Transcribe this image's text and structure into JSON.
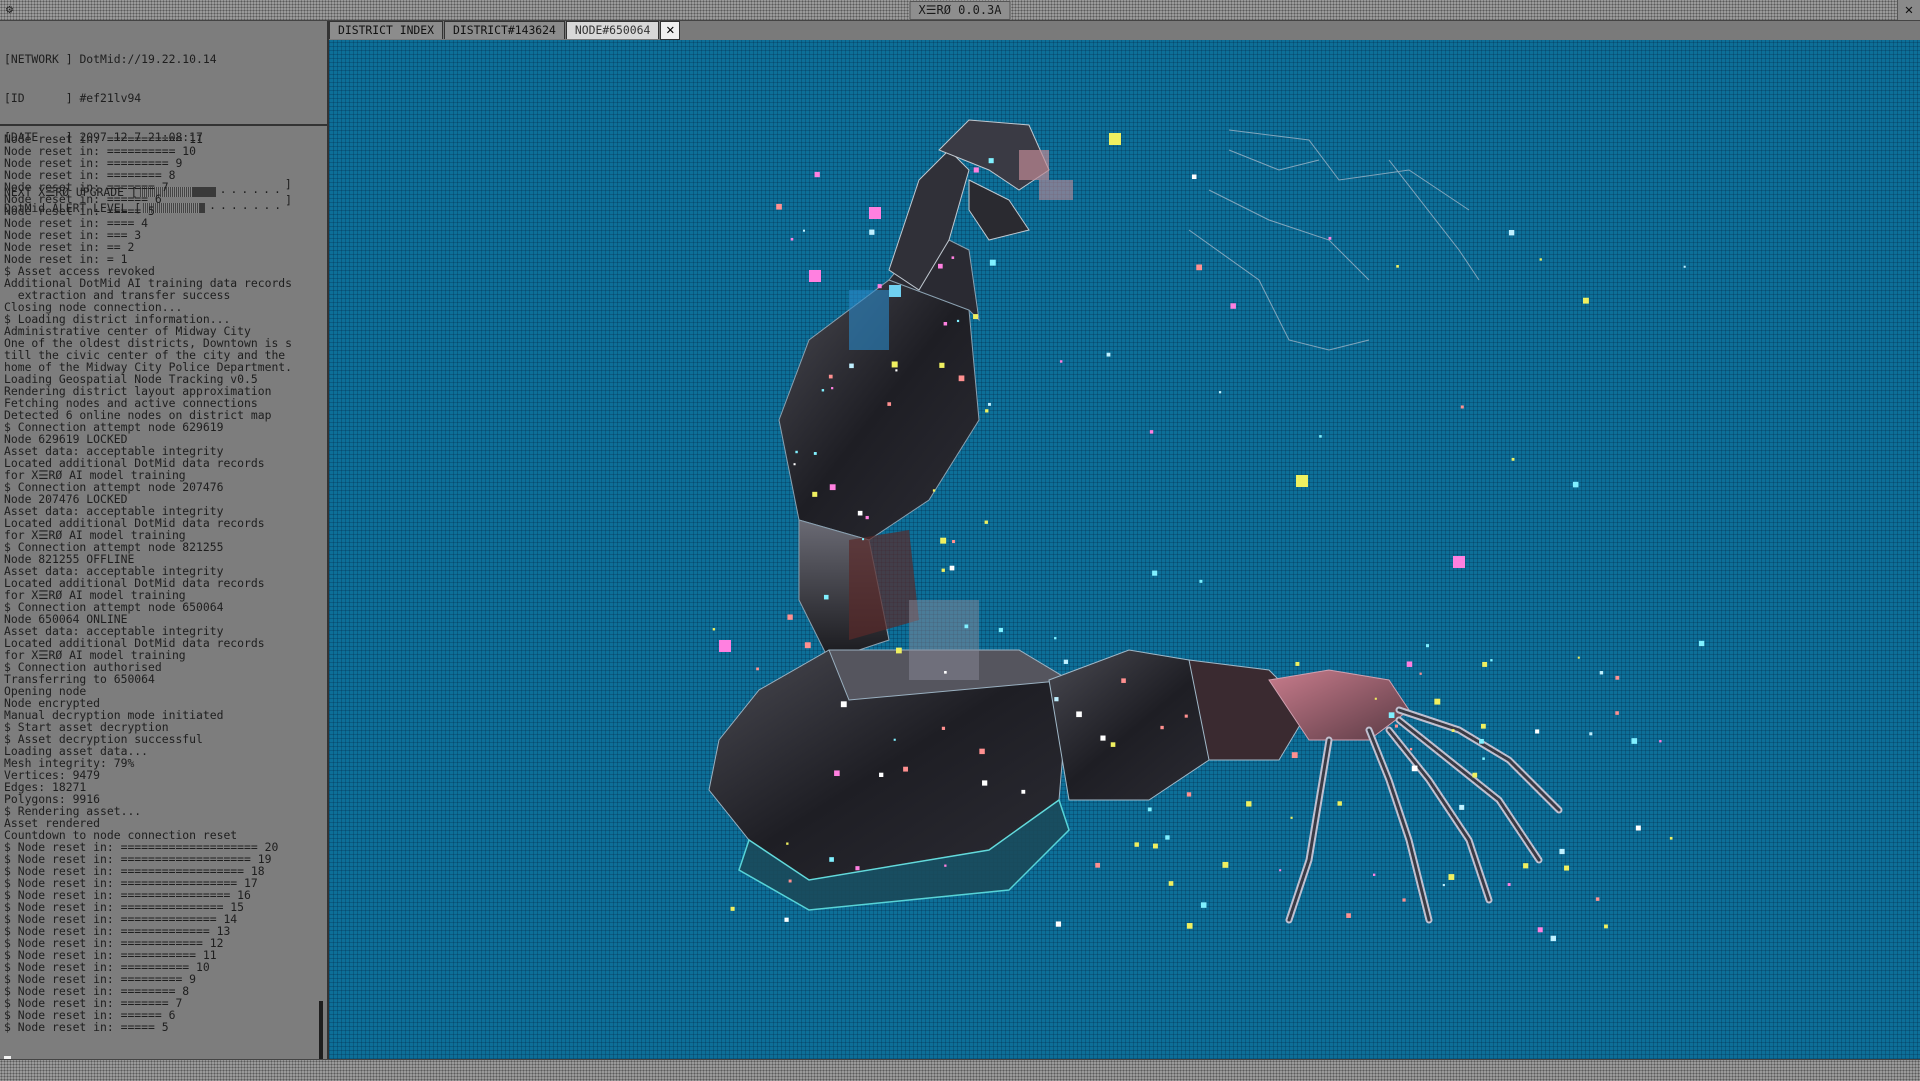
{
  "window": {
    "title": "X☰RØ 0.0.3A",
    "menu_icon": "gear-icon",
    "close_icon": "close-icon"
  },
  "info": {
    "network_label": "[NETWORK ]",
    "network_value": "DotMid://19.22.10.14",
    "id_label": "[ID      ]",
    "id_value": "#ef21lv94",
    "date_label": "[DATE    ]",
    "date_value": "2097-12-7 21:08:17"
  },
  "meters": {
    "upgrade_label": "NEXT X☰RØ UPGRADE [",
    "upgrade_level": 0.4,
    "alert_label": "DotMid ALERT LEVEL [",
    "alert_level": 0.45
  },
  "log": [
    "Node reset in: =========== 11",
    "Node reset in: ========== 10",
    "Node reset in: ========= 9",
    "Node reset in: ======== 8",
    "Node reset in: ======= 7",
    "Node reset in: ====== 6",
    "Node reset in: ===== 5",
    "Node reset in: ==== 4",
    "Node reset in: === 3",
    "Node reset in: == 2",
    "Node reset in: = 1",
    "$ Asset access revoked",
    "Additional DotMid AI training data records",
    "  extraction and transfer success",
    "Closing node connection...",
    "$ Loading district information...",
    "Administrative center of Midway City",
    "One of the oldest districts, Downtown is s",
    "till the civic center of the city and the",
    "home of the Midway City Police Department.",
    "Loading Geospatial Node Tracking v0.5",
    "Rendering district layout approximation",
    "Fetching nodes and active connections",
    "Detected 6 online nodes on district map",
    "$ Connection attempt node 629619",
    "Node 629619 LOCKED",
    "Asset data: acceptable integrity",
    "Located additional DotMid data records",
    "for X☰RØ AI model training",
    "$ Connection attempt node 207476",
    "Node 207476 LOCKED",
    "Asset data: acceptable integrity",
    "Located additional DotMid data records",
    "for X☰RØ AI model training",
    "$ Connection attempt node 821255",
    "Node 821255 OFFLINE",
    "Asset data: acceptable integrity",
    "Located additional DotMid data records",
    "for X☰RØ AI model training",
    "$ Connection attempt node 650064",
    "Node 650064 ONLINE",
    "Asset data: acceptable integrity",
    "Located additional DotMid data records",
    "for X☰RØ AI model training",
    "$ Connection authorised",
    "Transferring to 650064",
    "Opening node",
    "Node encrypted",
    "Manual decryption mode initiated",
    "$ Start asset decryption",
    "$ Asset decryption successful",
    "Loading asset data...",
    "Mesh integrity: 79%",
    "Vertices: 9479",
    "Edges: 18271",
    "Polygons: 9916",
    "$ Rendering asset...",
    "Asset rendered",
    "Countdown to node connection reset",
    "$ Node reset in: ==================== 20",
    "$ Node reset in: =================== 19",
    "$ Node reset in: ================== 18",
    "$ Node reset in: ================= 17",
    "$ Node reset in: ================ 16",
    "$ Node reset in: =============== 15",
    "$ Node reset in: ============== 14",
    "$ Node reset in: ============= 13",
    "$ Node reset in: ============ 12",
    "$ Node reset in: =========== 11",
    "$ Node reset in: ========== 10",
    "$ Node reset in: ========= 9",
    "$ Node reset in: ======== 8",
    "$ Node reset in: ======= 7",
    "$ Node reset in: ====== 6",
    "$ Node reset in: ===== 5"
  ],
  "tabs": [
    {
      "label": "DISTRICT INDEX",
      "active": false
    },
    {
      "label": "DISTRICT#143624",
      "active": false
    },
    {
      "label": "NODE#650064",
      "active": true
    }
  ],
  "tab_close_icon": "close-icon",
  "viewport": {
    "asset": "robotic-arm-render",
    "bg": "#0d6f98"
  }
}
